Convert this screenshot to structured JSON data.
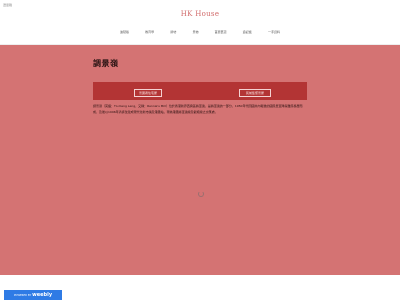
{
  "header": {
    "skip_label": "選單跳",
    "site_title": "HK House",
    "nav": [
      "進階版",
      "教育學",
      "牌坊",
      "景物",
      "首頁舊貨",
      "遊記板",
      "一手資料"
    ]
  },
  "main": {
    "heading": "調景嶺",
    "button_left": "景寶者住宅屋",
    "button_right": "民前集聚景屋",
    "body_text": "調景嶺（英語：Tiu Keng Leng，又稱：Rennie's Mill）位於香港新界西貢區將軍澳，是將軍澳的一部分，1950年代因國共內戰後的國民黨軍隊與難民移居而成，及後以1996年清拆改建成現代化新市鎮及港鐵站，現為港鐵將軍澳線及觀塘線之交匯處。"
  },
  "footer": {
    "powered_by": "POWERED BY",
    "brand": "weebly"
  }
}
